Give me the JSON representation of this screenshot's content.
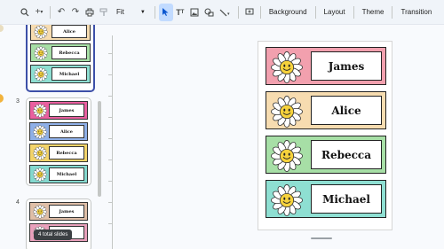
{
  "toolbar": {
    "zoom": "Fit",
    "background": "Background",
    "layout": "Layout",
    "theme": "Theme",
    "transition": "Transition"
  },
  "filmstrip": {
    "slide3_number": "3",
    "slide4_number": "4",
    "tooltip": "4 total slides"
  },
  "cards": [
    {
      "name": "James",
      "color": "#f2a0ae"
    },
    {
      "name": "Alice",
      "color": "#f7dcb0"
    },
    {
      "name": "Rebecca",
      "color": "#a7dfa6"
    },
    {
      "name": "Michael",
      "color": "#8edfd2"
    }
  ],
  "thumb3_cards": [
    {
      "name": "James",
      "color": "#ea5fa0"
    },
    {
      "name": "Alice",
      "color": "#8fb0e8"
    },
    {
      "name": "Rebecca",
      "color": "#f3d46a"
    },
    {
      "name": "Michael",
      "color": "#84d9cf"
    }
  ],
  "thumb4_cards": [
    {
      "name": "James",
      "color": "#e0bfa8"
    },
    {
      "name": "",
      "color": "#e9a0bb"
    }
  ]
}
